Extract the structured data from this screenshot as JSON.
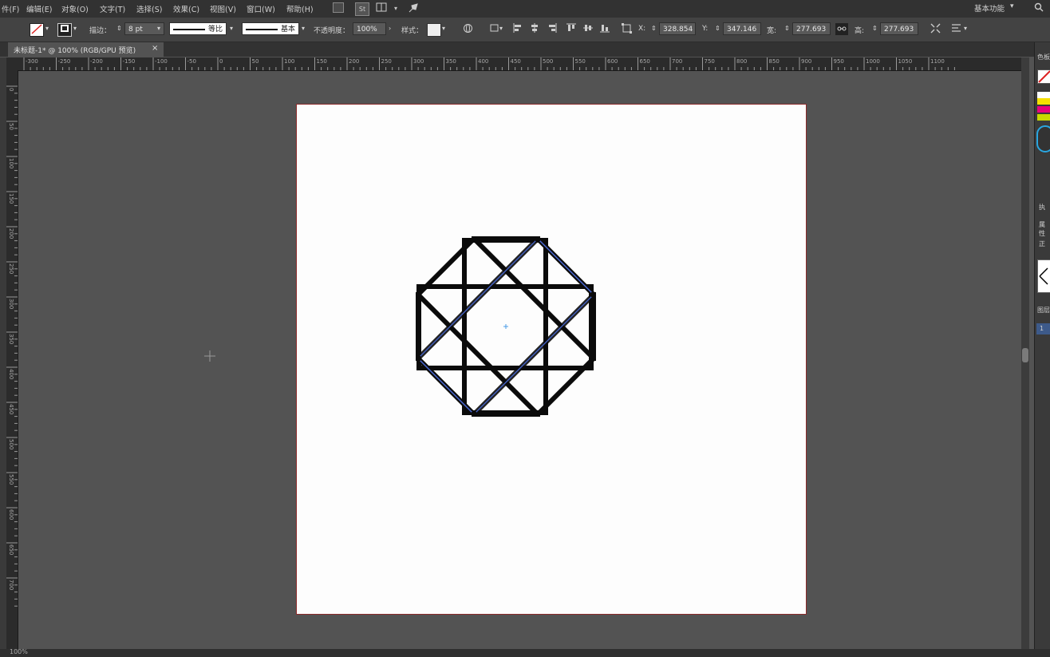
{
  "menu": {
    "items": [
      "件(F)",
      "编辑(E)",
      "对象(O)",
      "文字(T)",
      "选择(S)",
      "效果(C)",
      "视图(V)",
      "窗口(W)",
      "帮助(H)"
    ],
    "workspace": "基本功能",
    "br_icon": "Br",
    "st_icon": "St"
  },
  "control": {
    "stroke_label": "描边：",
    "stroke_weight": "8 pt",
    "profile_1": "等比",
    "profile_2": "基本",
    "opacity_label": "不透明度：",
    "opacity_value": "100%",
    "style_label": "样式：",
    "x_label": "X:",
    "x_value": "328.854",
    "y_label": "Y:",
    "y_value": "347.146",
    "w_label": "宽:",
    "w_value": "277.693",
    "h_label": "高:",
    "h_value": "277.693",
    "pt_unit": "pt"
  },
  "tab": {
    "title": "未标题-1* @ 100% (RGB/GPU 预览)",
    "close": "×"
  },
  "rulers": {
    "h_labels": [
      "-300",
      "-250",
      "-200",
      "-150",
      "-100",
      "-50",
      "0",
      "50",
      "100",
      "150",
      "200",
      "250",
      "300",
      "350",
      "400",
      "450",
      "500",
      "550",
      "600",
      "650",
      "700",
      "750",
      "800",
      "850",
      "900",
      "950",
      "1000",
      "1050",
      "1100"
    ],
    "v_labels": [
      "0",
      "50",
      "100",
      "150",
      "200",
      "250",
      "300",
      "350",
      "400",
      "450",
      "500",
      "550",
      "600",
      "650",
      "700"
    ]
  },
  "right_panel": {
    "label_a": "色板",
    "label_b": "执",
    "label_c": "属性",
    "label_d": "正",
    "label_e": "图层",
    "label_f": "1"
  },
  "status": {
    "zoom": "100%"
  },
  "colors": {
    "menubar": "#323232",
    "controlbar": "#434343",
    "canvas": "#535353",
    "artboard_border": "#8b2a2a",
    "selection": "#4a6bd8"
  },
  "icons": [
    "search-icon",
    "st-icon",
    "arrange-docs-icon",
    "rocket-icon",
    "no-fill-icon",
    "stroke-icon",
    "globe-icon",
    "align-left-icon",
    "align-center-icon",
    "align-right-icon",
    "align-top-icon",
    "align-middle-icon",
    "align-bottom-icon",
    "transform-icon",
    "link-icon",
    "panel-menu-icon",
    "cursor-crosshair-icon"
  ]
}
